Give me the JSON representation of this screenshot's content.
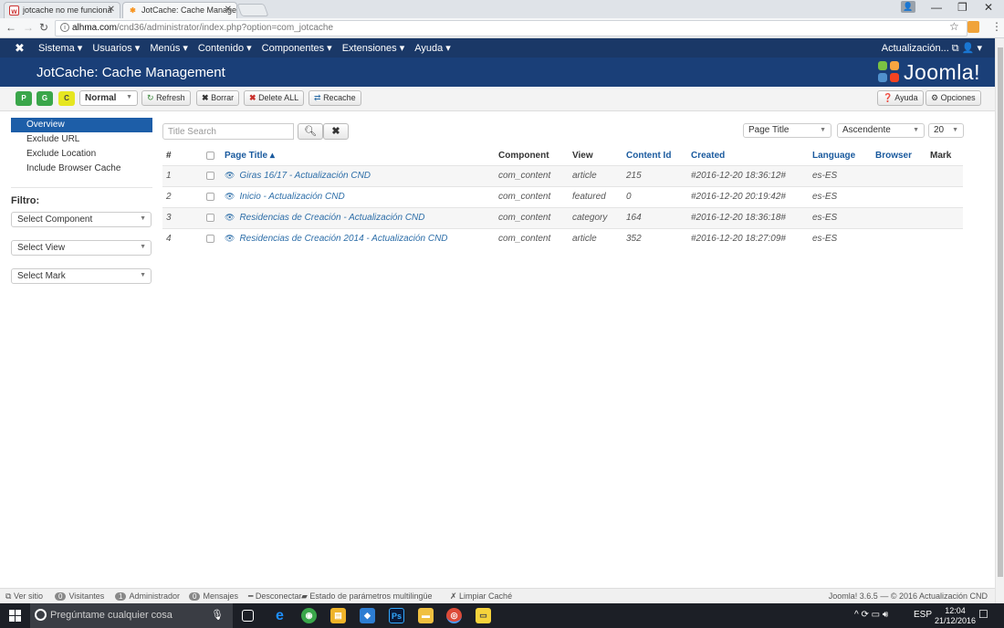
{
  "browser": {
    "tabs": [
      {
        "title": "jotcache no me funciona",
        "favicon": "w"
      },
      {
        "title": "JotCache: Cache Manage",
        "favicon": "joomla"
      }
    ],
    "url_host": "alhma.com",
    "url_path": "/cnd36/administrator/index.php?option=com_jotcache"
  },
  "nav": {
    "menu": [
      "Sistema ▾",
      "Usuarios ▾",
      "Menús ▾",
      "Contenido ▾",
      "Componentes ▾",
      "Extensiones ▾",
      "Ayuda ▾"
    ],
    "right": "Actualización... ⧉   👤 ▾"
  },
  "header": {
    "title": "JotCache: Cache Management",
    "logo_text": "Joomla!"
  },
  "toolbar": {
    "p": "P",
    "g": "G",
    "c": "C",
    "mode": "Normal",
    "refresh": "Refresh",
    "borrar": "Borrar",
    "delete_all": "Delete ALL",
    "recache": "Recache",
    "ayuda": "Ayuda",
    "opciones": "Opciones"
  },
  "sidebar": {
    "items": [
      "Overview",
      "Exclude URL",
      "Exclude Location",
      "Include Browser Cache"
    ],
    "filter_label": "Filtro:",
    "filters": [
      "Select Component",
      "Select View",
      "Select Mark"
    ]
  },
  "search": {
    "placeholder": "Title Search"
  },
  "sort": {
    "field": "Page Title",
    "direction": "Ascendente",
    "limit": "20"
  },
  "table": {
    "headers": [
      "#",
      "",
      "Page Title ▴",
      "Component",
      "View",
      "Content Id",
      "Created",
      "Language",
      "Browser",
      "Mark"
    ],
    "rows": [
      {
        "n": "1",
        "title": "Giras 16/17 - Actualización CND",
        "component": "com_content",
        "view": "article",
        "content_id": "215",
        "created": "#2016-12-20 18:36:12#",
        "language": "es-ES"
      },
      {
        "n": "2",
        "title": "Inicio - Actualización CND",
        "component": "com_content",
        "view": "featured",
        "content_id": "0",
        "created": "#2016-12-20 20:19:42#",
        "language": "es-ES"
      },
      {
        "n": "3",
        "title": "Residencias de Creación - Actualización CND",
        "component": "com_content",
        "view": "category",
        "content_id": "164",
        "created": "#2016-12-20 18:36:18#",
        "language": "es-ES"
      },
      {
        "n": "4",
        "title": "Residencias de Creación 2014 - Actualización CND",
        "component": "com_content",
        "view": "article",
        "content_id": "352",
        "created": "#2016-12-20 18:27:09#",
        "language": "es-ES"
      }
    ]
  },
  "statusbar": {
    "ver_sitio": "Ver sitio",
    "visitantes_count": "0",
    "visitantes": "Visitantes",
    "admin_count": "1",
    "administrador": "Administrador",
    "mensajes_count": "0",
    "mensajes": "Mensajes",
    "desconectar": "Desconectar",
    "estado": "Estado de parámetros multilingüe",
    "limpiar": "Limpiar Caché",
    "version": "Joomla! 3.6.5 — © 2016 Actualización CND"
  },
  "taskbar": {
    "search_placeholder": "Pregúntame cualquier cosa",
    "lang": "ESP",
    "time": "12:04",
    "date": "21/12/2016"
  },
  "colors": {
    "nav": "#1a3867",
    "header": "#1a3f78",
    "active": "#1d5ea8",
    "link": "#2d6ea8"
  }
}
